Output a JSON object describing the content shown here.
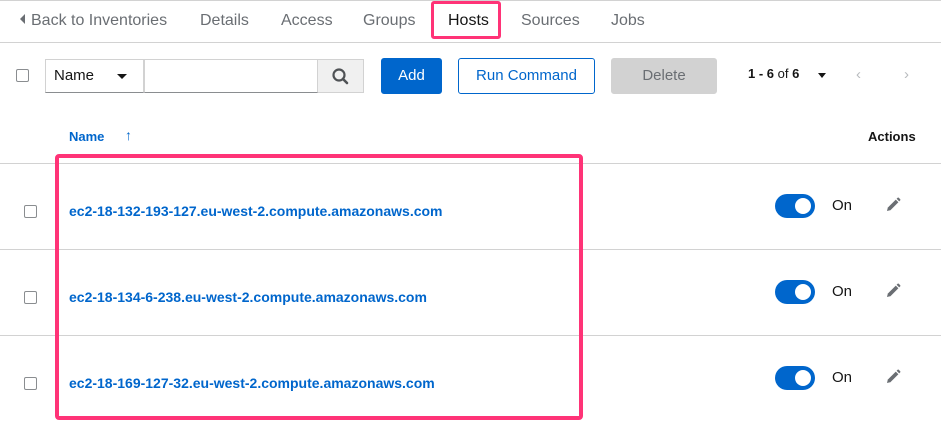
{
  "tabs": {
    "back_label": "Back to Inventories",
    "items": [
      "Details",
      "Access",
      "Groups",
      "Hosts",
      "Sources",
      "Jobs"
    ],
    "active": "Hosts"
  },
  "toolbar": {
    "filter_select": "Name",
    "search_placeholder": "",
    "add_label": "Add",
    "run_command_label": "Run Command",
    "delete_label": "Delete",
    "pagination": {
      "range": "1 - 6",
      "of_label": "of",
      "total": "6"
    }
  },
  "table": {
    "columns": {
      "name": "Name",
      "actions": "Actions"
    },
    "sort_icon": "up-arrow-icon",
    "rows": [
      {
        "name": "ec2-18-132-193-127.eu-west-2.compute.amazonaws.com",
        "enabled": true,
        "state_label": "On"
      },
      {
        "name": "ec2-18-134-6-238.eu-west-2.compute.amazonaws.com",
        "enabled": true,
        "state_label": "On"
      },
      {
        "name": "ec2-18-169-127-32.eu-west-2.compute.amazonaws.com",
        "enabled": true,
        "state_label": "On"
      }
    ]
  },
  "colors": {
    "accent": "#0066cc",
    "highlight": "#ff3377",
    "disabled": "#d2d2d2"
  }
}
